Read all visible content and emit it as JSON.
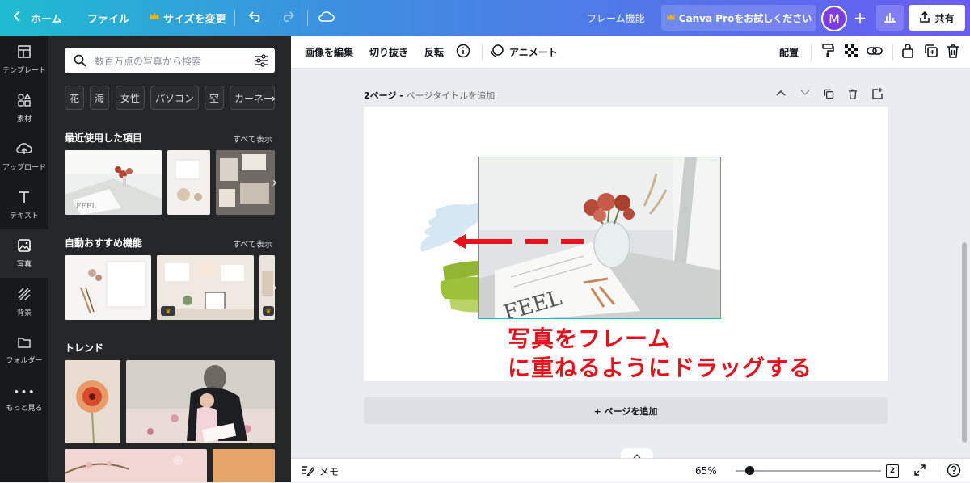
{
  "topbar": {
    "home_label": "ホーム",
    "file_label": "ファイル",
    "resize_label": "サイズを変更",
    "frame_feature_label": "フレーム機能",
    "pro_trial_label": "Canva Proをお試しください",
    "avatar_initial": "M",
    "share_label": "共有"
  },
  "rail": {
    "items": [
      {
        "label": "テンプレート",
        "icon": "template-icon"
      },
      {
        "label": "素材",
        "icon": "elements-icon"
      },
      {
        "label": "アップロード",
        "icon": "upload-cloud-icon"
      },
      {
        "label": "テキスト",
        "icon": "text-icon"
      },
      {
        "label": "写真",
        "icon": "photo-icon"
      },
      {
        "label": "背景",
        "icon": "background-icon"
      },
      {
        "label": "フォルダー",
        "icon": "folder-icon"
      },
      {
        "label": "もっと見る",
        "icon": "more-icon"
      }
    ]
  },
  "panel": {
    "search_placeholder": "数百万点の写真から検索",
    "chips": [
      "花",
      "海",
      "女性",
      "パソコン",
      "空",
      "カーネー"
    ],
    "recent_title": "最近使用した項目",
    "featured_title": "自動おすすめ機能",
    "trend_title": "トレンド",
    "see_all": "すべて表示"
  },
  "toolbar": {
    "edit_image": "画像を編集",
    "crop": "切り抜き",
    "flip": "反転",
    "animate": "アニメート",
    "position": "配置"
  },
  "page": {
    "label_number": "2ページ - ",
    "label_title": "ページタイトルを追加",
    "photo_text": "FEEL",
    "add_page": "+ ページを追加"
  },
  "annotation": {
    "line1": "写真をフレーム",
    "line2": "に重ねるようにドラッグする"
  },
  "bottombar": {
    "notes": "メモ",
    "zoom": "65%",
    "page_count": "2"
  },
  "colors": {
    "accent_red": "#e8101a",
    "selection": "#00c4cc",
    "crown": "#f7b500"
  }
}
